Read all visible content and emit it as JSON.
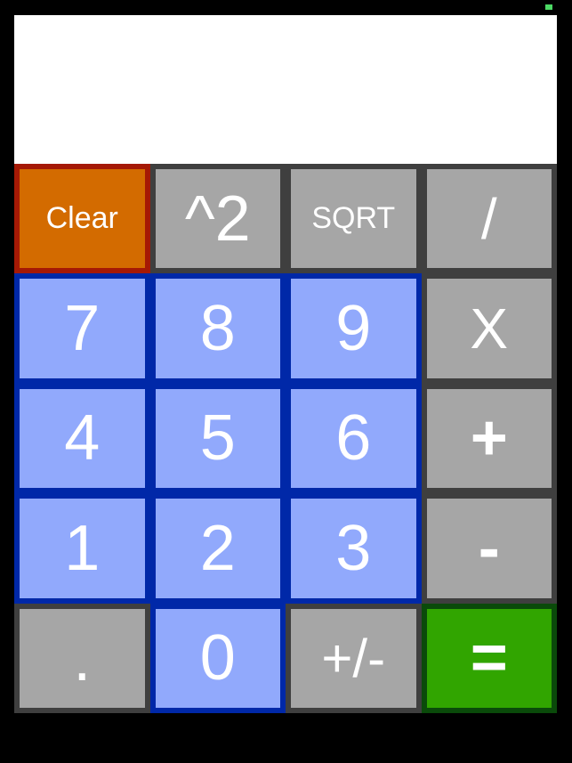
{
  "status": {
    "indicator_color": "#4cd964"
  },
  "display": {
    "value": ""
  },
  "colors": {
    "number_key_bg": "#91a9fc",
    "number_key_border": "#0028a8",
    "operator_key_bg": "#a6a6a6",
    "operator_key_border": "#3f3f3f",
    "clear_key_bg": "#d36b00",
    "clear_key_border": "#a51905",
    "equals_key_bg": "#31a500",
    "equals_key_border": "#0a4a0a"
  },
  "keys": {
    "clear": "Clear",
    "square": "^2",
    "sqrt": "SQRT",
    "divide": "/",
    "seven": "7",
    "eight": "8",
    "nine": "9",
    "multiply": "X",
    "four": "4",
    "five": "5",
    "six": "6",
    "add": "+",
    "one": "1",
    "two": "2",
    "three": "3",
    "subtract": "-",
    "decimal": ".",
    "zero": "0",
    "negate": "+/-",
    "equals": "="
  }
}
